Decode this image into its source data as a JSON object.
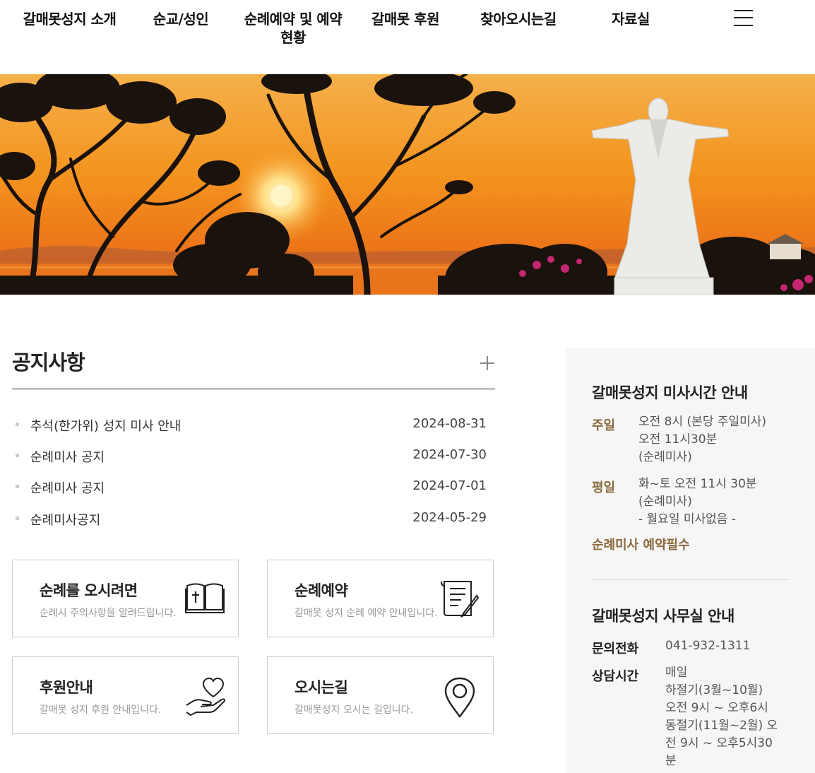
{
  "nav": {
    "items": [
      {
        "label": "갈매못성지 소개"
      },
      {
        "label": "순교/성인"
      },
      {
        "label": "순례예약 및 예약현황"
      },
      {
        "label": "갈매못 후원"
      },
      {
        "label": "찾아오시는길"
      },
      {
        "label": "자료실"
      }
    ],
    "menu_icon": "hamburger-menu-icon"
  },
  "banner": {
    "slide_count": 4,
    "active_slide": 2,
    "colors": {
      "sky_top": "#f7a23a",
      "sky_mid": "#f28a1c",
      "horizon": "#e8651a",
      "sun": "#fff6c8",
      "silhouette": "#1a120c",
      "statue": "#e9e9e6"
    }
  },
  "notice": {
    "title": "공지사항",
    "more_icon": "plus-icon",
    "items": [
      {
        "title": "추석(한가위) 성지 미사 안내",
        "date": "2024-08-31"
      },
      {
        "title": "순례미사 공지",
        "date": "2024-07-30"
      },
      {
        "title": "순례미사 공지",
        "date": "2024-07-01"
      },
      {
        "title": "순례미사공지",
        "date": "2024-05-29"
      }
    ]
  },
  "cards": [
    {
      "title": "순례를 오시려면",
      "desc": "순례시 주의사항을 알려드립니다.",
      "icon": "bible-icon"
    },
    {
      "title": "순례예약",
      "desc": "갈매못 성지 순례 예약 안내입니다.",
      "icon": "document-pen-icon"
    },
    {
      "title": "후원안내",
      "desc": "갈매못 성지 후원 안내입니다.",
      "icon": "heart-hand-icon"
    },
    {
      "title": "오시는길",
      "desc": "갈매못성지 오시는 길입니다.",
      "icon": "map-pin-icon"
    }
  ],
  "mass": {
    "title": "갈매못성지 미사시간 안내",
    "sunday_label": "주일",
    "sunday_lines": [
      "오전 8시 (본당 주일미사)",
      "오전 11시30분",
      "(순례미사)"
    ],
    "weekday_label": "평일",
    "weekday_lines": [
      "화~토 오전 11시 30분",
      "(순례미사)",
      "- 월요일 미사없음 -"
    ],
    "note": "순례미사 예약필수"
  },
  "office": {
    "title": "갈매못성지 사무실 안내",
    "phone_label": "문의전화",
    "phone": "041-932-1311",
    "hours_label": "상담시간",
    "hours_lines": [
      "매일",
      "하절기(3월~10월)",
      "오전 9시 ~ 오후6시",
      "동절기(11월~2월) 오",
      "전 9시 ~ 오후5시30",
      "분"
    ]
  },
  "colors": {
    "accent": "#8a6a3c",
    "panel_bg": "#f6f6f6"
  }
}
